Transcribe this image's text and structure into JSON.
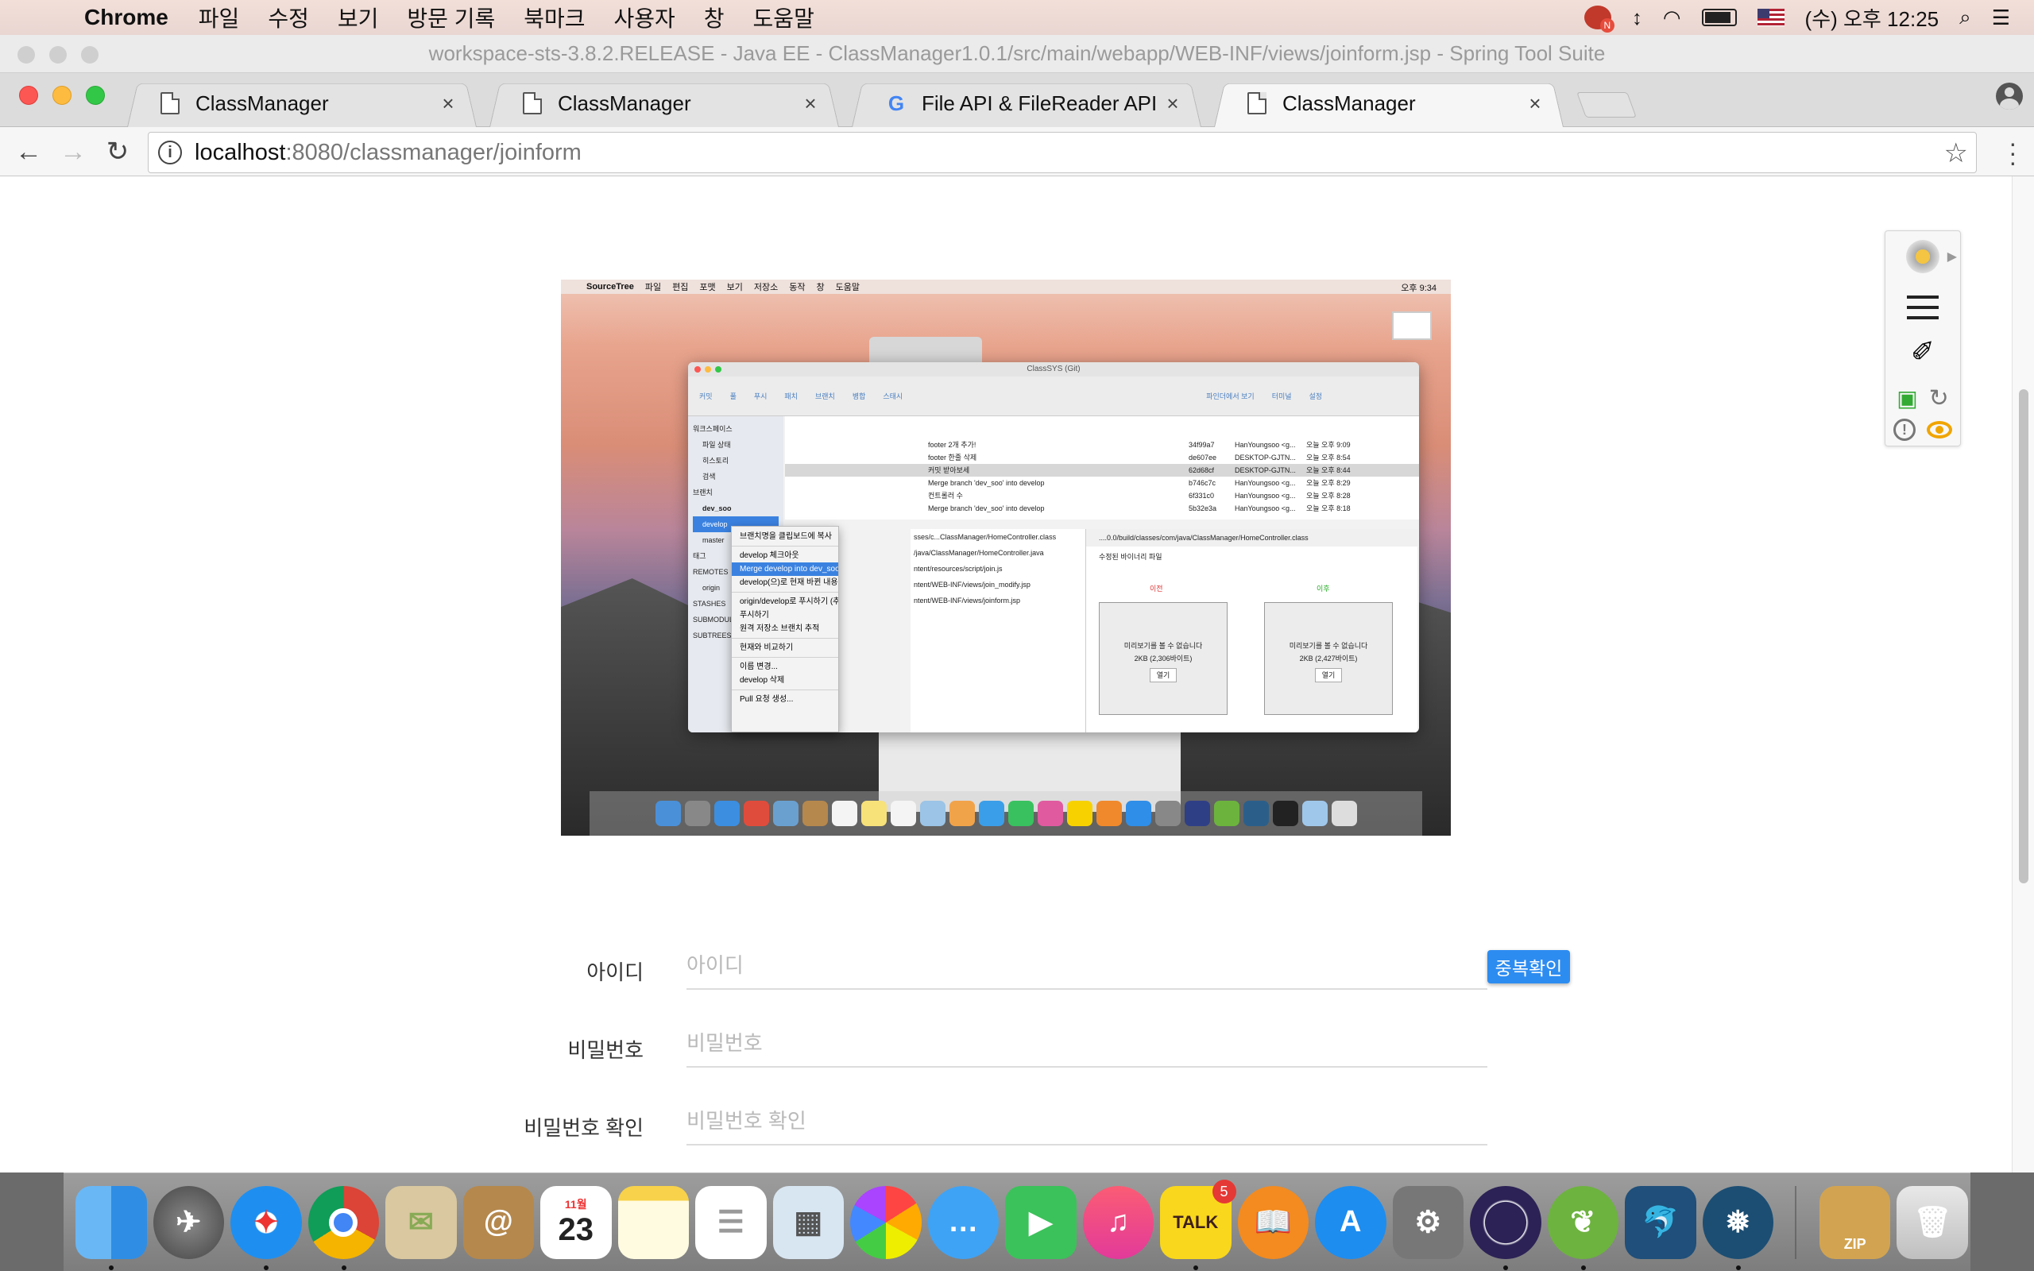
{
  "menubar": {
    "app_name": "Chrome",
    "items": [
      "파일",
      "수정",
      "보기",
      "방문 기록",
      "북마크",
      "사용자",
      "창",
      "도움말"
    ],
    "clock": "(수) 오후 12:25"
  },
  "sts_window": {
    "title": "workspace-sts-3.8.2.RELEASE - Java EE - ClassManager1.0.1/src/main/webapp/WEB-INF/views/joinform.jsp - Spring Tool Suite"
  },
  "tabs": [
    {
      "title": "ClassManager",
      "close": "×"
    },
    {
      "title": "ClassManager",
      "close": "×"
    },
    {
      "title": "File API & FileReader API not s",
      "close": "×"
    },
    {
      "title": "ClassManager",
      "close": "×"
    }
  ],
  "address": {
    "host": "localhost",
    "path": ":8080/classmanager/joinform"
  },
  "screenshot": {
    "menubar": [
      "SourceTree",
      "파일",
      "편집",
      "포맷",
      "보기",
      "저장소",
      "동작",
      "창",
      "도움말"
    ],
    "clock": "오후 9:34",
    "window_title": "ClassSYS (Git)",
    "toolbar": [
      "커밋",
      "풀",
      "푸시",
      "패치",
      "브랜치",
      "병합",
      "스태시",
      "파인더에서 보기",
      "터미널",
      "설정"
    ],
    "sidebar": [
      "워크스페이스",
      "파일 상태",
      "히스토리",
      "검색",
      "브랜치",
      "dev_soo",
      "develop",
      "master",
      "태그",
      "REMOTES",
      "origin",
      "STASHES",
      "SUBMODULES",
      "SUBTREES"
    ],
    "commits": [
      {
        "msg": "footer 2개 추가!",
        "hash": "34f99a7",
        "author": "HanYoungsoo <g...",
        "date": "오늘 오후 9:09"
      },
      {
        "msg": "footer 한줄 삭제",
        "hash": "de607ee",
        "author": "DESKTOP-GJTN...",
        "date": "오늘 오후 8:54"
      },
      {
        "msg": "커밋 받아보세",
        "hash": "62d68cf",
        "author": "DESKTOP-GJTN...",
        "date": "오늘 오후 8:44"
      },
      {
        "msg": "Merge branch 'dev_soo' into develop",
        "hash": "b746c7c",
        "author": "HanYoungsoo <g...",
        "date": "오늘 오후 8:29"
      },
      {
        "msg": "컨트롤러 수",
        "hash": "6f331c0",
        "author": "HanYoungsoo <g...",
        "date": "오늘 오후 8:28"
      },
      {
        "msg": "Merge branch 'dev_soo' into develop",
        "hash": "5b32e3a",
        "author": "HanYoungsoo <g...",
        "date": "오늘 오후 8:18"
      }
    ],
    "files": [
      "sses/c...ClassManager/HomeController.class",
      "/java/ClassManager/HomeController.java",
      "ntent/resources/script/join.js",
      "ntent/WEB-INF/views/join_modify.jsp",
      "ntent/WEB-INF/views/joinform.jsp"
    ],
    "diff_header": "....0.0/build/classes/com/java/ClassManager/HomeController.class",
    "diff_sub": "수정된 바이너리 파일",
    "before_label": "이전",
    "after_label": "이후",
    "before_box": "미리보기를 볼 수 없습니다",
    "before_size": "2KB (2,306바이트)",
    "after_box": "미리보기를 볼 수 없습니다",
    "after_size": "2KB (2,427바이트)",
    "open_btn": "열기",
    "context_menu": [
      "브랜치명을 클립보드에 복사",
      "develop 체크아웃",
      "Merge develop into dev_soo",
      "develop(으)로 현재 바뀐 내용 재배치",
      "origin/develop로 푸시하기 (추적됨)",
      "푸시하기",
      "원격 저장소 브랜치 추적",
      "현재와 비교하기",
      "이름 변경...",
      "develop 삭제",
      "Pull 요청 생성..."
    ]
  },
  "form": {
    "id_label": "아이디",
    "id_placeholder": "아이디",
    "dup_button": "중복확인",
    "pw_label": "비밀번호",
    "pw_placeholder": "비밀번호",
    "pw_confirm_label": "비밀번호 확인",
    "pw_confirm_placeholder": "비밀번호 확인"
  },
  "dock": {
    "calendar_month": "11월",
    "calendar_day": "23",
    "talk_badge": "5",
    "talk_label": "TALK",
    "zip_label": "ZIP"
  },
  "colors": {
    "accent": "#2d8cf0",
    "menu_highlight": "#3b82e0"
  }
}
